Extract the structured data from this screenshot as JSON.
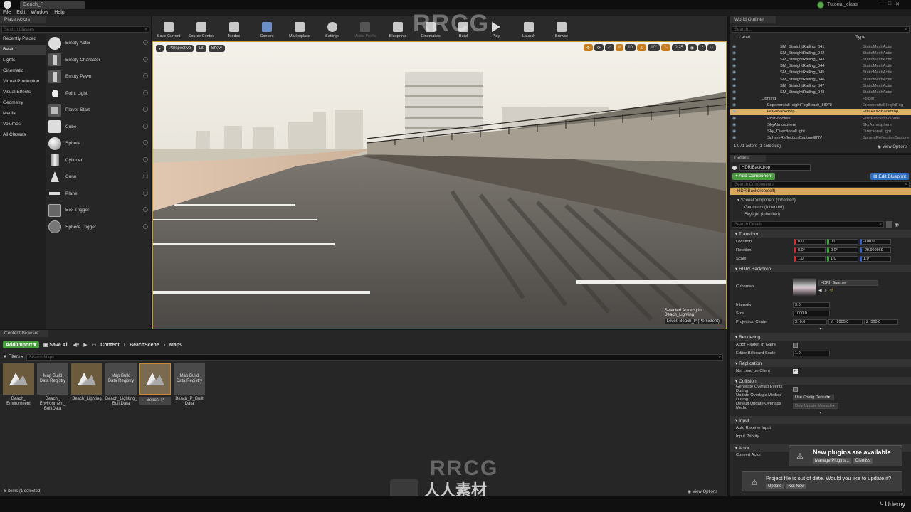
{
  "window": {
    "tab_title": "Beach_P",
    "project": "Tutorial_class"
  },
  "menu": [
    "File",
    "Edit",
    "Window",
    "Help"
  ],
  "place_actors": {
    "title": "Place Actors",
    "search_placeholder": "Search Classes",
    "categories": [
      "Recently Placed",
      "Basic",
      "Lights",
      "Cinematic",
      "Virtual Production",
      "Visual Effects",
      "Geometry",
      "Media",
      "Volumes",
      "All Classes"
    ],
    "items": [
      "Empty Actor",
      "Empty Character",
      "Empty Pawn",
      "Point Light",
      "Player Start",
      "Cube",
      "Sphere",
      "Cylinder",
      "Cone",
      "Plane",
      "Box Trigger",
      "Sphere Trigger"
    ]
  },
  "toolbar": [
    "Save Current",
    "Source Control",
    "Modes",
    "Content",
    "Marketplace",
    "Settings",
    "Media Profile",
    "Blueprints",
    "Cinematics",
    "Build",
    "Play",
    "Launch",
    "Browse"
  ],
  "viewport": {
    "perspective": "Perspective",
    "lit": "Lit",
    "show": "Show",
    "snap_grid": "10",
    "snap_rot": "10°",
    "snap_scale": "0.25",
    "cam_speed": "2",
    "selected": "Selected Actor(s) in",
    "sub_level": "Beach_Lighting",
    "level": "Level:  Beach_P (Persistent)"
  },
  "content_browser": {
    "title": "Content Browser",
    "add_import": "Add/Import",
    "save_all": "Save All",
    "path": [
      "Content",
      "BeachScene",
      "Maps"
    ],
    "filters": "Filters",
    "search_placeholder": "Search Maps",
    "assets": [
      {
        "name": "Beach_\nEnvironment",
        "kind": "map"
      },
      {
        "name": "Beach_\nEnvironment_\nBuiltData",
        "kind": "registry",
        "thumb": "Map Build\nData Registry"
      },
      {
        "name": "Beach_Lighting",
        "kind": "map"
      },
      {
        "name": "Beach_Lighting_\nBuiltData",
        "kind": "registry",
        "thumb": "Map Build\nData Registry"
      },
      {
        "name": "Beach_P",
        "kind": "map",
        "selected": true
      },
      {
        "name": "Beach_P_Built\nData",
        "kind": "registry",
        "thumb": "Map Build\nData Registry"
      }
    ],
    "status": "6 items (1 selected)",
    "view_options": "View Options"
  },
  "outliner": {
    "title": "World Outliner",
    "search_placeholder": "Search...",
    "col_label": "Label",
    "col_type": "Type",
    "rows": [
      {
        "label": "SM_StraightRailing_041",
        "type": "StaticMeshActor",
        "indent": 60
      },
      {
        "label": "SM_StraightRailing_042",
        "type": "StaticMeshActor",
        "indent": 60
      },
      {
        "label": "SM_StraightRailing_043",
        "type": "StaticMeshActor",
        "indent": 60
      },
      {
        "label": "SM_StraightRailing_044",
        "type": "StaticMeshActor",
        "indent": 60
      },
      {
        "label": "SM_StraightRailing_045",
        "type": "StaticMeshActor",
        "indent": 60
      },
      {
        "label": "SM_StraightRailing_046",
        "type": "StaticMeshActor",
        "indent": 60
      },
      {
        "label": "SM_StraightRailing_047",
        "type": "StaticMeshActor",
        "indent": 60
      },
      {
        "label": "SM_StraightRailing_048",
        "type": "StaticMeshActor",
        "indent": 60
      },
      {
        "label": "Lighting",
        "type": "Folder",
        "indent": 34
      },
      {
        "label": "ExponentialHeightFogBeach_HDRI",
        "type": "ExponentialHeightFog",
        "indent": 42
      },
      {
        "label": "HDRIBackdrop",
        "type": "Edit HDRIBackdrop",
        "indent": 42,
        "selected": true
      },
      {
        "label": "PostProcess",
        "type": "PostProcessVolume",
        "indent": 42
      },
      {
        "label": "SkyAtmosphere",
        "type": "SkyAtmosphere",
        "indent": 42
      },
      {
        "label": "Sky_DirectionalLight",
        "type": "DirectionalLight",
        "indent": 42
      },
      {
        "label": "SphereReflectionCaptureENV",
        "type": "SphereReflectionCapture",
        "indent": 42
      }
    ],
    "count": "1,071 actors (1 selected)",
    "view_options": "View Options"
  },
  "details": {
    "title": "Details",
    "actor_name": "HDRIBackdrop",
    "add_component": "+ Add Component",
    "edit_blueprint": "Edit Blueprint",
    "search_components": "Search Components",
    "self": "HDRIBackdrop(self)",
    "components": [
      "SceneComponent (Inherited)",
      "Geometry (Inherited)",
      "Skylight (Inherited)"
    ],
    "search_details": "Search Details",
    "transform": {
      "title": "Transform",
      "location": [
        "0.0",
        "0.0",
        "-100.0"
      ],
      "rotation": [
        "0.0°",
        "0.0°",
        "-29.999969"
      ],
      "scale": [
        "1.0",
        "1.0",
        "1.0"
      ],
      "labels": [
        "Location",
        "Rotation",
        "Scale"
      ]
    },
    "hdri": {
      "title": "HDRI Backdrop",
      "cubemap_label": "Cubemap",
      "cubemap": "HDRI_Sunrise",
      "intensity_label": "Intensity",
      "intensity": "3.0",
      "size_label": "Size",
      "size": "1000.0",
      "projection_label": "Projection Center",
      "projection": [
        "0.0",
        "-2000.0",
        "500.0"
      ]
    },
    "rendering": {
      "title": "Rendering",
      "hidden": "Actor Hidden In Game",
      "billboard": "Editor Billboard Scale",
      "billboard_val": "1.0"
    },
    "replication": {
      "title": "Replication",
      "net_load": "Net Load on Client"
    },
    "collision": {
      "title": "Collision",
      "gen_overlap": "Generate Overlap Events During",
      "update_method": "Update Overlaps Method During",
      "update_val": "Use Config Default",
      "default_method": "Default Update Overlaps Metho",
      "default_val": "Only Update Movable"
    },
    "input": {
      "title": "Input",
      "auto_receive": "Auto Receive Input",
      "priority": "Input Priority"
    },
    "actor": {
      "title": "Actor",
      "convert": "Convert Actor",
      "select_type": "Select a Type"
    }
  },
  "toasts": {
    "plugins": {
      "title": "New plugins are available",
      "manage": "Manage Plugins...",
      "dismiss": "Dismiss"
    },
    "project": {
      "text": "Project file is out of date. Would you like to update it?",
      "update": "Update",
      "not_now": "Not Now"
    }
  },
  "watermarks": [
    "RRCG",
    "人人素材"
  ],
  "brand": "Udemy",
  "colors": {
    "accent_green": "#4a9d3f",
    "accent_blue": "#2b6fc2",
    "selection": "#c88a3a",
    "viewport_border": "#c89a2b"
  }
}
